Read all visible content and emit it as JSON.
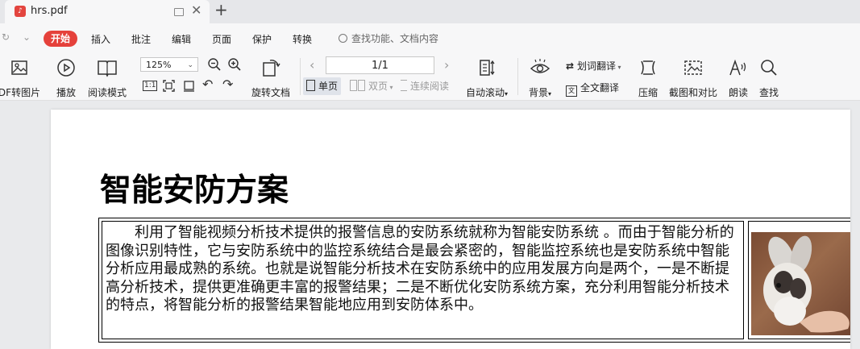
{
  "tab": {
    "title": "hrs.pdf",
    "plus": "+",
    "close": "✕"
  },
  "menu": {
    "items": [
      "开始",
      "插入",
      "批注",
      "编辑",
      "页面",
      "保护",
      "转换"
    ],
    "search": "查找功能、文档内容"
  },
  "toolbar": {
    "pdf_to_image": "DF转图片",
    "play": "播放",
    "read_mode": "阅读模式",
    "zoom": "125%",
    "rotate_doc": "旋转文档",
    "page_indicator": "1/1",
    "single_page": "单页",
    "double_page": "双页",
    "continuous": "连续阅读",
    "auto_scroll": "自动滚动",
    "background": "背景",
    "word_translate": "划词翻译",
    "full_translate": "全文翻译",
    "compress": "压缩",
    "screenshot_compare": "截图和对比",
    "read_aloud": "朗读",
    "find": "查找",
    "one_to_one": "1:1"
  },
  "document": {
    "title": "智能安防方案",
    "paragraph": "利用了智能视频分析技术提供的报警信息的安防系统就称为智能安防系统 。而由于智能分析的图像识别特性，它与安防系统中的监控系统结合是最会紧密的，智能监控系统也是安防系统中智能分析应用最成熟的系统。也就是说智能分析技术在安防系统中的应用发展方向是两个，一是不断提高分析技术，提供更准确更丰富的报警结果；二是不断优化安防系统方案，充分利用智能分析技术的特点，将智能分析的报警结果智能地应用到安防体系中。"
  },
  "colors": {
    "accent": "#e5413b",
    "pdf_icon": "#e3453f"
  }
}
